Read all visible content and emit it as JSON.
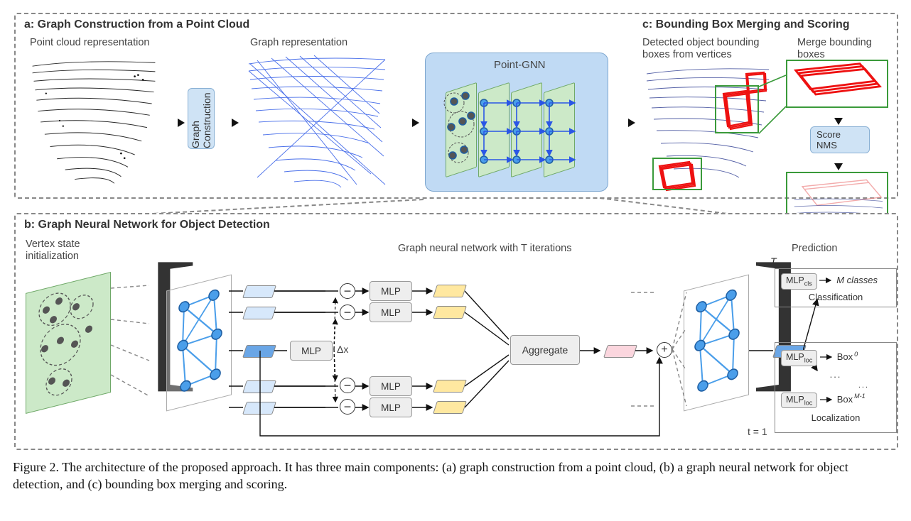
{
  "panelA": {
    "title": "a: Graph Construction from a Point Cloud",
    "pointcloudLabel": "Point cloud representation",
    "graphLabel": "Graph representation",
    "graphConstruction": "Graph Construction",
    "pointGnn": "Point-GNN"
  },
  "panelC": {
    "title": "c: Bounding Box Merging and Scoring",
    "detectedLabel": "Detected object bounding boxes from vertices",
    "mergeLabel": "Merge bounding boxes",
    "scoreNms": "Score NMS"
  },
  "panelB": {
    "title": "b: Graph Neural Network for Object Detection",
    "vertexInit": "Vertex state initialization",
    "gnnIter": "Graph neural network with T iterations",
    "mlp": "MLP",
    "aggregate": "Aggregate",
    "deltaX": "Δx",
    "tLabelTop": "T",
    "tLabelBottom": "t = 1",
    "prediction": "Prediction",
    "classification": "Classification",
    "localization": "Localization",
    "mlpCls": "MLP",
    "mlpClsSub": "cls",
    "mlpLoc": "MLP",
    "mlpLocSub": "loc",
    "mClasses": "M classes",
    "box0": "Box",
    "box0sup": "0",
    "boxM1": "Box",
    "boxM1sup": "M-1",
    "ellipsis": "...",
    "ellipsis2": "..."
  },
  "caption": "Figure 2. The architecture of the proposed approach. It has three main components: (a) graph construction from a point cloud, (b) a graph neural network for object detection, and (c) bounding box merging and scoring."
}
